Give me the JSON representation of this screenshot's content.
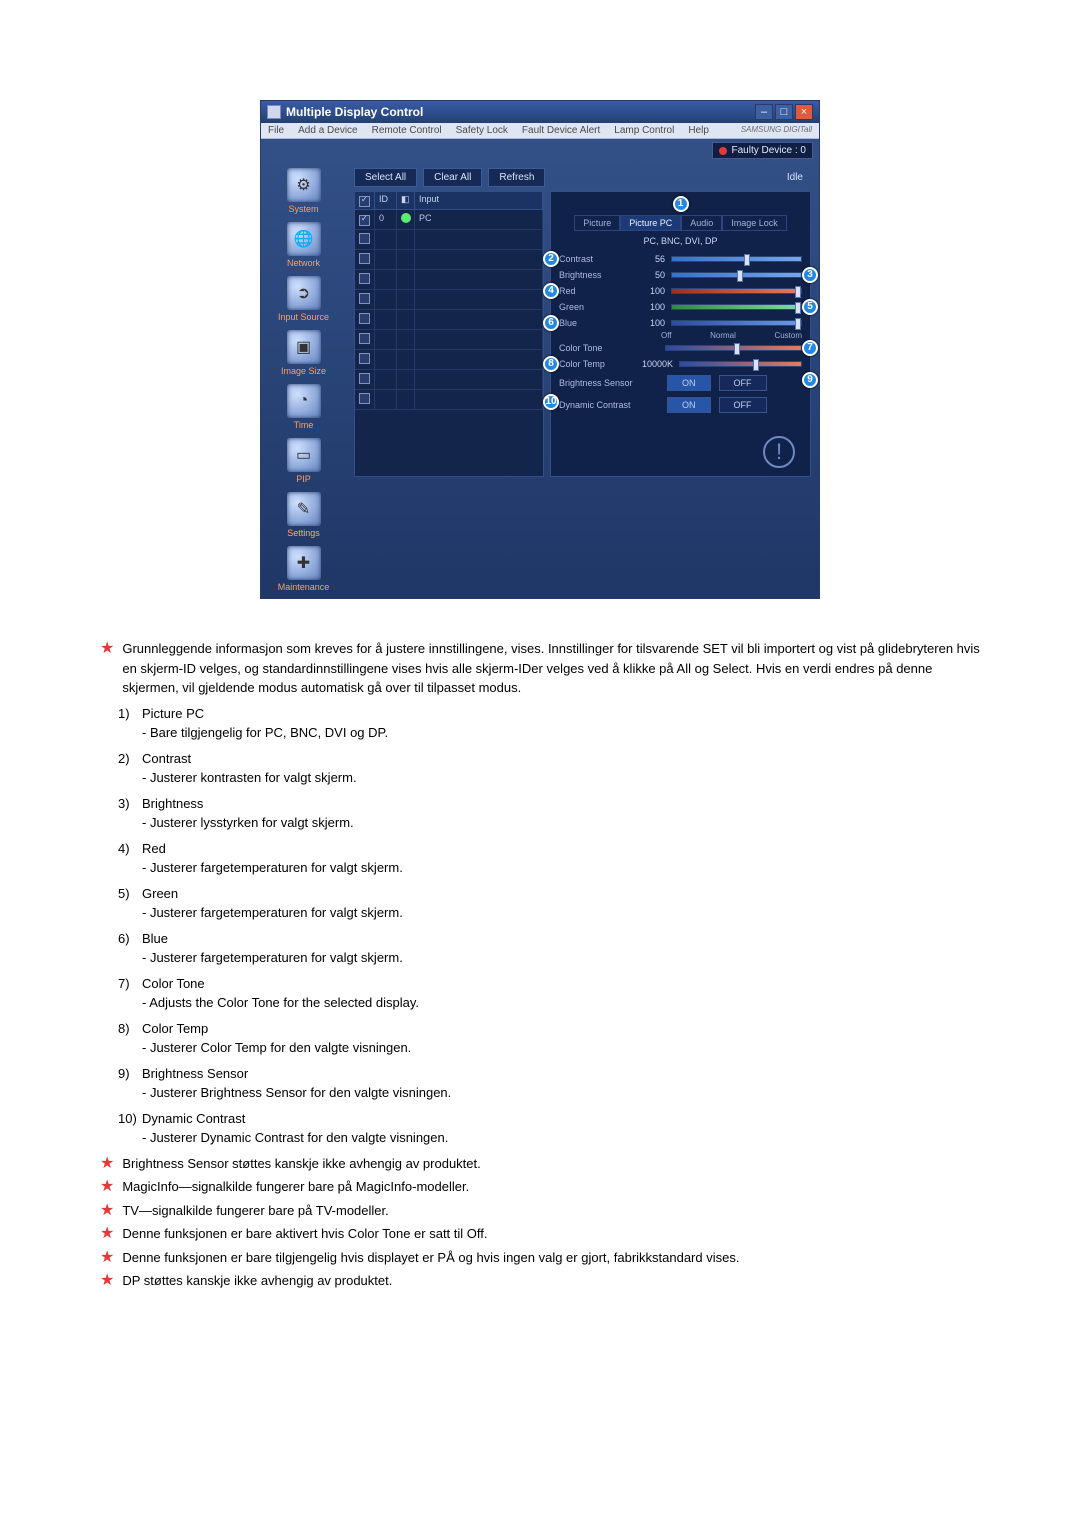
{
  "window": {
    "title": "Multiple Display Control",
    "brand": "SAMSUNG DIGITall"
  },
  "menu": [
    "File",
    "Add a Device",
    "Remote Control",
    "Safety Lock",
    "Fault Device Alert",
    "Lamp Control",
    "Help"
  ],
  "status": {
    "label": "Faulty Device : 0"
  },
  "sidebar": [
    {
      "label": "System",
      "glyph": "⚙"
    },
    {
      "label": "Network",
      "glyph": "🌐"
    },
    {
      "label": "Input Source",
      "glyph": "➲"
    },
    {
      "label": "Image Size",
      "glyph": "▣"
    },
    {
      "label": "Time",
      "glyph": "◔"
    },
    {
      "label": "PIP",
      "glyph": "▭"
    },
    {
      "label": "Settings",
      "glyph": "✎"
    },
    {
      "label": "Maintenance",
      "glyph": "✚"
    }
  ],
  "buttons": {
    "select_all": "Select All",
    "clear_all": "Clear All",
    "refresh": "Refresh",
    "idle": "Idle"
  },
  "table": {
    "headers": {
      "chk": "✓",
      "id": "ID",
      "st": "",
      "input": "Input"
    },
    "rows": [
      {
        "checked": true,
        "id": "0",
        "input": "PC"
      }
    ],
    "blank_rows": 9
  },
  "panel": {
    "tabs": [
      "Picture",
      "Picture PC",
      "Audio",
      "Image Lock"
    ],
    "active_tab": 1,
    "sub_header": "PC, BNC, DVI, DP",
    "contrast": {
      "label": "Contrast",
      "value": "56",
      "pos": 56
    },
    "brightness": {
      "label": "Brightness",
      "value": "50",
      "pos": 50
    },
    "red": {
      "label": "Red",
      "value": "100",
      "pos": 100
    },
    "green": {
      "label": "Green",
      "value": "100",
      "pos": 100
    },
    "blue": {
      "label": "Blue",
      "value": "100",
      "pos": 100
    },
    "color_tone": {
      "label": "Color Tone",
      "ticks": [
        "Off",
        "Normal",
        "Custom"
      ],
      "pos": 50
    },
    "color_temp": {
      "label": "Color Temp",
      "value": "10000K",
      "pos": 60
    },
    "brightness_sensor": {
      "label": "Brightness Sensor",
      "on": "ON",
      "off": "OFF"
    },
    "dynamic_contrast": {
      "label": "Dynamic Contrast",
      "on": "ON",
      "off": "OFF"
    }
  },
  "callouts": {
    "c1": "1",
    "c2": "2",
    "c3": "3",
    "c4": "4",
    "c5": "5",
    "c6": "6",
    "c7": "7",
    "c8": "8",
    "c9": "9",
    "c10": "10"
  },
  "desc": {
    "intro": "Grunnleggende informasjon som kreves for å justere innstillingene, vises. Innstillinger for tilsvarende SET vil bli importert og vist på glidebryteren hvis en skjerm-ID velges, og standardinnstillingene vises hvis alle skjerm-IDer velges ved å klikke på All og Select. Hvis en verdi endres på denne skjermen, vil gjeldende modus automatisk gå over til tilpasset modus.",
    "items": [
      {
        "n": "1)",
        "t": "Picture PC",
        "s": "- Bare tilgjengelig for PC, BNC, DVI og DP."
      },
      {
        "n": "2)",
        "t": "Contrast",
        "s": "- Justerer kontrasten for valgt skjerm."
      },
      {
        "n": "3)",
        "t": "Brightness",
        "s": "- Justerer lysstyrken for valgt skjerm."
      },
      {
        "n": "4)",
        "t": "Red",
        "s": "- Justerer fargetemperaturen for valgt skjerm."
      },
      {
        "n": "5)",
        "t": "Green",
        "s": "- Justerer fargetemperaturen for valgt skjerm."
      },
      {
        "n": "6)",
        "t": "Blue",
        "s": "- Justerer fargetemperaturen for valgt skjerm."
      },
      {
        "n": "7)",
        "t": "Color Tone",
        "s": "- Adjusts the Color Tone for the selected display."
      },
      {
        "n": "8)",
        "t": "Color Temp",
        "s": "- Justerer Color Temp for den valgte visningen."
      },
      {
        "n": "9)",
        "t": "Brightness Sensor",
        "s": "- Justerer Brightness Sensor for den valgte visningen."
      },
      {
        "n": "10)",
        "t": "Dynamic Contrast",
        "s": "- Justerer Dynamic Contrast for den valgte visningen."
      }
    ],
    "notes": [
      "Brightness Sensor støttes kanskje ikke avhengig av produktet.",
      "MagicInfo—signalkilde fungerer bare på MagicInfo-modeller.",
      "TV—signalkilde fungerer bare på TV-modeller.",
      "Denne funksjonen er bare aktivert hvis Color Tone er satt til Off.",
      "Denne funksjonen er bare tilgjengelig hvis displayet er PÅ og hvis ingen valg er gjort, fabrikkstandard vises.",
      "DP støttes kanskje ikke avhengig av produktet."
    ]
  }
}
